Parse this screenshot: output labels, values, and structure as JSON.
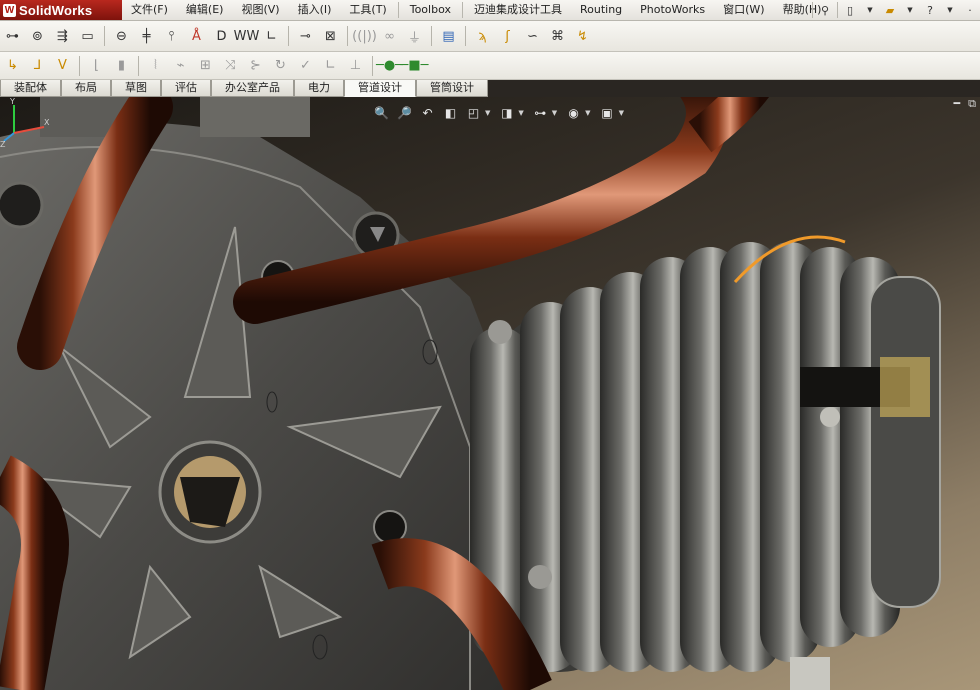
{
  "app": {
    "brand": "SolidWorks",
    "logo_letter": "W"
  },
  "menu": {
    "items": [
      "文件(F)",
      "编辑(E)",
      "视图(V)",
      "插入(I)",
      "工具(T)",
      "Toolbox",
      "迈迪集成设计工具",
      "Routing",
      "PhotoWorks",
      "窗口(W)",
      "帮助(H)"
    ],
    "right_icons": [
      "pin-icon",
      "new-document-icon",
      "open-folder-icon",
      "help-icon"
    ]
  },
  "toolbar1": {
    "icons": [
      "chain-icon",
      "ring-icon",
      "fastener-icon",
      "bolt-icon",
      "slot-icon",
      "pin-icon",
      "wire-icon",
      "lamp-icon",
      "bracket-icon",
      "coil-icon",
      "corner-icon",
      "probe-icon",
      "box-frame-icon",
      "spring-icon",
      "link-icon",
      "support-icon",
      "stack-icon",
      "route-auto-icon",
      "pipe-bend-icon",
      "rope-icon",
      "camera-route-icon",
      "flex-route-icon"
    ]
  },
  "toolbar2": {
    "icons": [
      "route-start-icon",
      "fitting-icon",
      "valve-icon",
      "flange-icon",
      "split-icon",
      "edit-route-icon",
      "add-point-icon",
      "tee-icon",
      "elbow-icon",
      "reducer-icon",
      "rotate-route-icon",
      "check-icon",
      "corner-route-icon",
      "clip-icon",
      "connector-icon",
      "terminal-icon"
    ]
  },
  "tabs": [
    {
      "label": "装配体",
      "active": false
    },
    {
      "label": "布局",
      "active": false
    },
    {
      "label": "草图",
      "active": false
    },
    {
      "label": "评估",
      "active": false
    },
    {
      "label": "办公室产品",
      "active": false
    },
    {
      "label": "电力",
      "active": false
    },
    {
      "label": "管道设计",
      "active": true
    },
    {
      "label": "管筒设计",
      "active": false
    }
  ],
  "viewport": {
    "heads_up_icons": [
      "zoom-to-fit-icon",
      "zoom-area-icon",
      "previous-view-icon",
      "section-view-icon",
      "view-orientation-icon",
      "display-style-icon",
      "hide-show-icon",
      "appearance-icon",
      "scene-icon"
    ],
    "corner_icons": [
      "minimize-pane-icon",
      "restore-pane-icon"
    ],
    "triad_labels": {
      "x": "X",
      "y": "Y",
      "z": "Z"
    }
  }
}
